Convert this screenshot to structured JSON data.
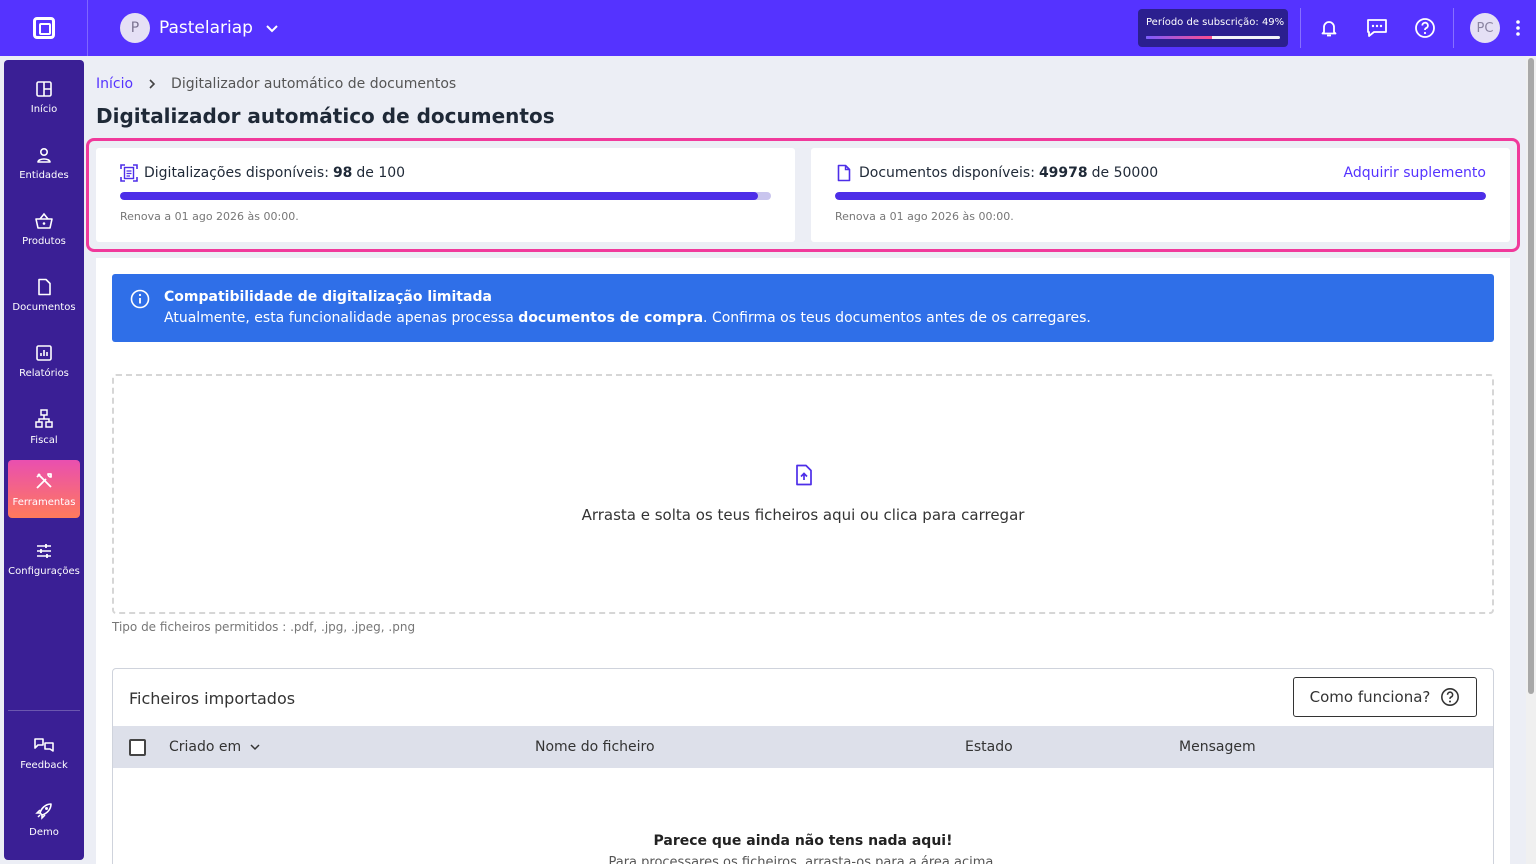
{
  "topbar": {
    "company_initial": "P",
    "company_name": "Pastelariap",
    "subscription_label": "Período de subscrição: 49%",
    "subscription_progress": 0.49,
    "user_initials": "PC"
  },
  "sidebar": {
    "items": [
      {
        "label": "Início",
        "icon": "grid-icon"
      },
      {
        "label": "Entidades",
        "icon": "user-icon"
      },
      {
        "label": "Produtos",
        "icon": "basket-icon"
      },
      {
        "label": "Documentos",
        "icon": "document-icon"
      },
      {
        "label": "Relatórios",
        "icon": "chart-icon"
      },
      {
        "label": "Fiscal",
        "icon": "hierarchy-icon"
      },
      {
        "label": "Ferramentas",
        "icon": "tools-icon"
      },
      {
        "label": "Configurações",
        "icon": "sliders-icon"
      },
      {
        "label": "Feedback",
        "icon": "feedback-icon"
      },
      {
        "label": "Demo",
        "icon": "rocket-icon"
      }
    ],
    "active": "Ferramentas"
  },
  "breadcrumb": {
    "home": "Início",
    "current": "Digitalizador automático de documentos"
  },
  "page": {
    "title": "Digitalizador automático de documentos"
  },
  "quota": {
    "scans": {
      "label": "Digitalizações disponíveis:",
      "used": "98",
      "of": "de 100",
      "fraction": 0.98,
      "renew": "Renova a 01 ago 2026 às 00:00."
    },
    "docs": {
      "label": "Documentos disponíveis:",
      "used": "49978",
      "of": "de 50000",
      "fraction": 0.99956,
      "renew": "Renova a 01 ago 2026 às 00:00.",
      "link": "Adquirir suplemento"
    }
  },
  "alert": {
    "title": "Compatibilidade de digitalização limitada",
    "text_before": "Atualmente, esta funcionalidade apenas processa",
    "text_bold": "documentos de compra",
    "text_after": ". Confirma os teus documentos antes de os carregares."
  },
  "upload": {
    "prompt": "Arrasta e solta os teus ficheiros aqui ou clica para carregar",
    "filetypes": "Tipo de ficheiros permitidos : .pdf, .jpg, .jpeg, .png"
  },
  "imported": {
    "title": "Ficheiros importados",
    "help_button": "Como funciona?",
    "columns": [
      "Criado em",
      "Nome do ficheiro",
      "Estado",
      "Mensagem"
    ],
    "empty_title": "Parece que ainda não tens nada aqui!",
    "empty_sub": "Para processares os ficheiros, arrasta-os para a área acima."
  },
  "colors": {
    "brand": "#5533ff",
    "sidebar": "#3a1f95",
    "alert": "#2f6fe8",
    "highlight": "#f0399b"
  }
}
